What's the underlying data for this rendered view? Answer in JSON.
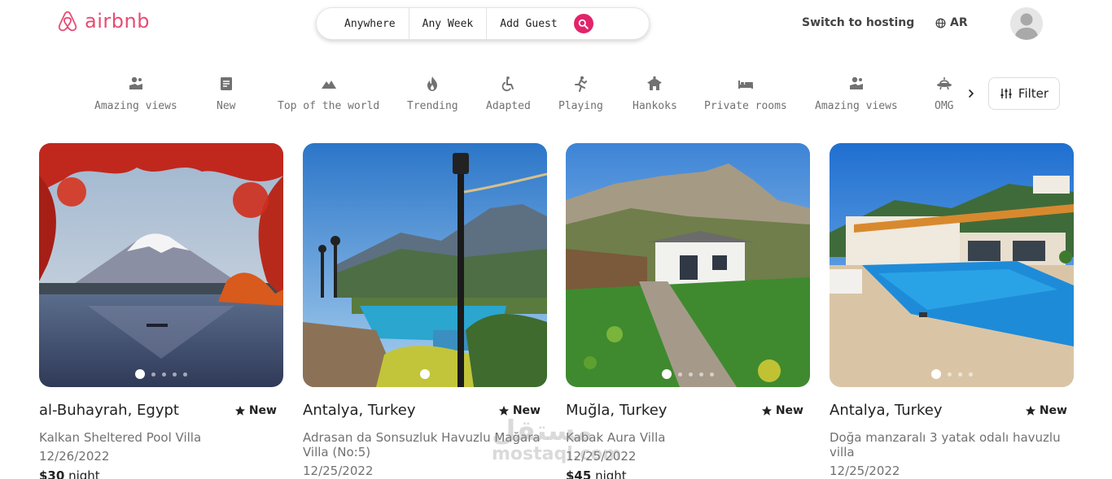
{
  "header": {
    "logo_text": "airbnb",
    "brand_color": "#e84b73",
    "search": {
      "where": "Anywhere",
      "when": "Any Week",
      "who": "Add Guest",
      "accent": "#e3236b"
    },
    "host_link": "Switch to hosting",
    "language": "AR"
  },
  "categories": [
    {
      "label": "Amazing views",
      "icon": "amazing-views-icon"
    },
    {
      "label": "New",
      "icon": "new-icon"
    },
    {
      "label": "Top of the world",
      "icon": "mountain-icon"
    },
    {
      "label": "Trending",
      "icon": "fire-icon"
    },
    {
      "label": "Adapted",
      "icon": "accessible-icon"
    },
    {
      "label": "Playing",
      "icon": "playing-icon"
    },
    {
      "label": "Hankoks",
      "icon": "hanok-icon"
    },
    {
      "label": "Private rooms",
      "icon": "bed-icon"
    },
    {
      "label": "Amazing views",
      "icon": "amazing-views-icon"
    },
    {
      "label": "OMG",
      "icon": "ufo-icon"
    }
  ],
  "filter_label": "Filter",
  "listings": [
    {
      "location": "al-Buhayrah, Egypt",
      "badge": "New",
      "title": "Kalkan Sheltered Pool Villa",
      "date": "12/26/2022",
      "price": "$30",
      "price_unit": "night",
      "photo_count": 5,
      "active_photo": 1
    },
    {
      "location": "Antalya, Turkey",
      "badge": "New",
      "title": "Adrasan da Sonsuzluk Havuzlu Mağara Villa (No:5)",
      "date": "12/25/2022",
      "photo_count": 1,
      "active_photo": 1
    },
    {
      "location": "Muğla, Turkey",
      "badge": "New",
      "title": "Kabak Aura Villa",
      "date": "12/25/2022",
      "price": "$45",
      "price_unit": "night",
      "photo_count": 5,
      "active_photo": 1
    },
    {
      "location": "Antalya, Turkey",
      "badge": "New",
      "title": "Doğa manzaralı 3 yatak odalı havuzlu villa",
      "date": "12/25/2022",
      "photo_count": 4,
      "active_photo": 1
    }
  ],
  "watermark": {
    "arabic": "مستقل",
    "latin": "mostaql.com"
  }
}
